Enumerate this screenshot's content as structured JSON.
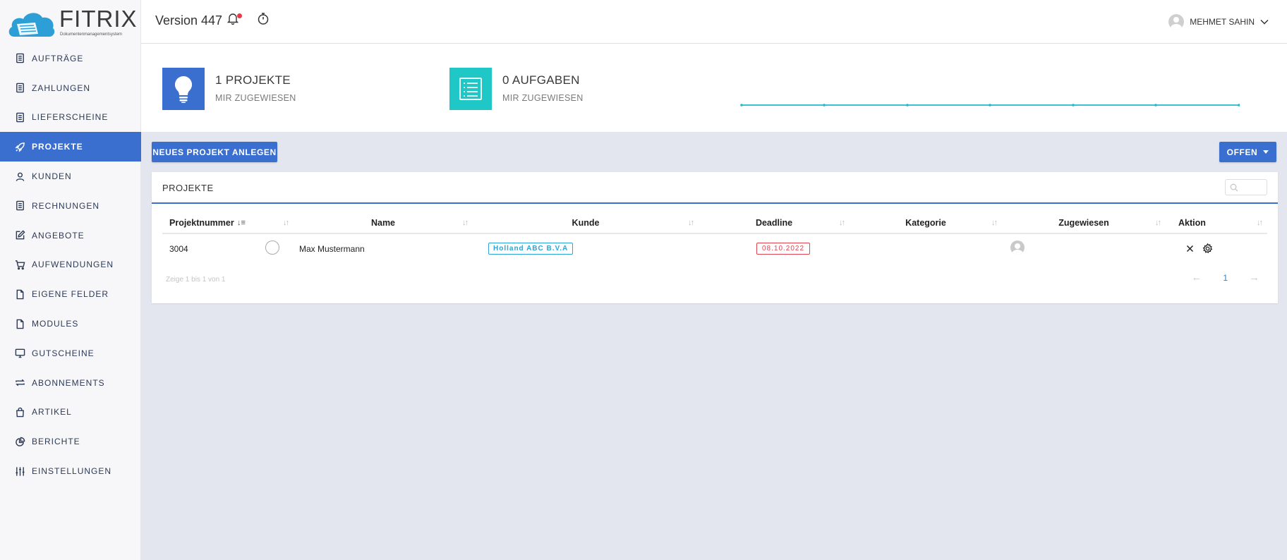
{
  "app": {
    "brand": "FITRIX",
    "brand_sub": "Dokumentenmanagementsystem",
    "version_label": "Version 447",
    "user_name": "MEHMET SAHIN"
  },
  "sidebar": {
    "items": [
      {
        "label": "AUFTRÄGE",
        "icon": "document-icon"
      },
      {
        "label": "ZAHLUNGEN",
        "icon": "document-icon"
      },
      {
        "label": "LIEFERSCHEINE",
        "icon": "document-icon"
      },
      {
        "label": "PROJEKTE",
        "icon": "rocket-icon",
        "active": true
      },
      {
        "label": "KUNDEN",
        "icon": "user-icon"
      },
      {
        "label": "RECHNUNGEN",
        "icon": "document-icon"
      },
      {
        "label": "ANGEBOTE",
        "icon": "edit-icon"
      },
      {
        "label": "AUFWENDUNGEN",
        "icon": "cart-icon"
      },
      {
        "label": "EIGENE FELDER",
        "icon": "file-icon"
      },
      {
        "label": "MODULES",
        "icon": "file-icon"
      },
      {
        "label": "GUTSCHEINE",
        "icon": "monitor-icon"
      },
      {
        "label": "ABONNEMENTS",
        "icon": "repeat-icon"
      },
      {
        "label": "ARTIKEL",
        "icon": "bag-icon"
      },
      {
        "label": "BERICHTE",
        "icon": "pie-chart-icon"
      },
      {
        "label": "EINSTELLUNGEN",
        "icon": "sliders-icon"
      }
    ]
  },
  "stats": {
    "projects": {
      "title": "1 PROJEKTE",
      "sub": "MIR ZUGEWIESEN",
      "color": "#3a6fd0"
    },
    "tasks": {
      "title": "0 AUFGABEN",
      "sub": "MIR ZUGEWIESEN",
      "color": "#1fc7c7"
    }
  },
  "toolbar": {
    "new_project_label": "NEUES PROJEKT ANLEGEN",
    "filter_label": "OFFEN"
  },
  "projects_card": {
    "title": "PROJEKTE",
    "columns": [
      "Projektnummer",
      "",
      "Name",
      "Kunde",
      "Deadline",
      "Kategorie",
      "Zugewiesen",
      "Aktion"
    ],
    "rows": [
      {
        "number": "3004",
        "name": "Max Mustermann",
        "customer": "Holland ABC B.V.A",
        "deadline": "08.10.2022",
        "category": ""
      }
    ],
    "info": "Zeige 1 bis 1 von 1",
    "page": "1"
  },
  "colors": {
    "accent": "#3a6fd0",
    "teal": "#1fc7c7",
    "danger": "#e04452",
    "info": "#2ba4d8"
  }
}
